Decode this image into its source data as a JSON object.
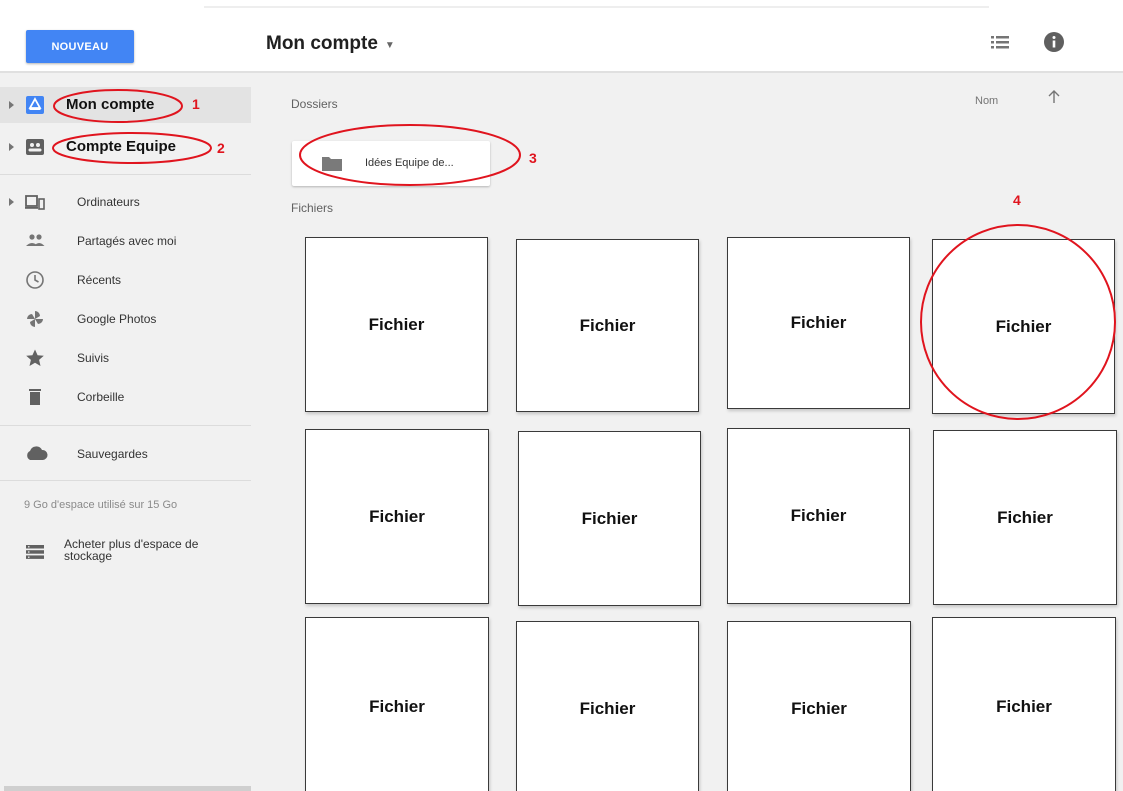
{
  "header": {
    "new_button": "NOUVEAU",
    "title": "Mon compte",
    "title_caret_icon": "caret-down-icon",
    "list_view_icon": "list-view-icon",
    "info_icon": "info-icon"
  },
  "sidebar": {
    "primary": [
      {
        "label": "Mon compte",
        "icon": "drive-icon",
        "selected": true,
        "annotation": "1"
      },
      {
        "label": "Compte Equipe",
        "icon": "team-drive-icon",
        "selected": false,
        "annotation": "2"
      }
    ],
    "items": [
      {
        "label": "Ordinateurs",
        "icon": "computers-icon"
      },
      {
        "label": "Partagés avec moi",
        "icon": "shared-people-icon"
      },
      {
        "label": "Récents",
        "icon": "clock-icon"
      },
      {
        "label": "Google Photos",
        "icon": "pinwheel-icon"
      },
      {
        "label": "Suivis",
        "icon": "star-icon"
      },
      {
        "label": "Corbeille",
        "icon": "trash-icon"
      }
    ],
    "backups": {
      "label": "Sauvegardes",
      "icon": "cloud-icon"
    },
    "storage_text": "9 Go d'espace utilisé sur 15 Go",
    "buy_storage": {
      "label": "Acheter plus d'espace de stockage",
      "icon": "storage-icon"
    }
  },
  "main": {
    "folders_heading": "Dossiers",
    "files_heading": "Fichiers",
    "sort_label": "Nom",
    "sort_icon": "arrow-up-icon",
    "folder": {
      "name": "Idées Equipe de...",
      "icon": "folder-icon",
      "annotation": "3"
    },
    "files": [
      "Fichier",
      "Fichier",
      "Fichier",
      "Fichier",
      "Fichier",
      "Fichier",
      "Fichier",
      "Fichier",
      "Fichier",
      "Fichier",
      "Fichier",
      "Fichier"
    ],
    "file_annotation": "4"
  },
  "colors": {
    "accent": "#4285f4",
    "annotation_red": "#e0141e",
    "sidebar_bg": "#f1f1f1"
  }
}
